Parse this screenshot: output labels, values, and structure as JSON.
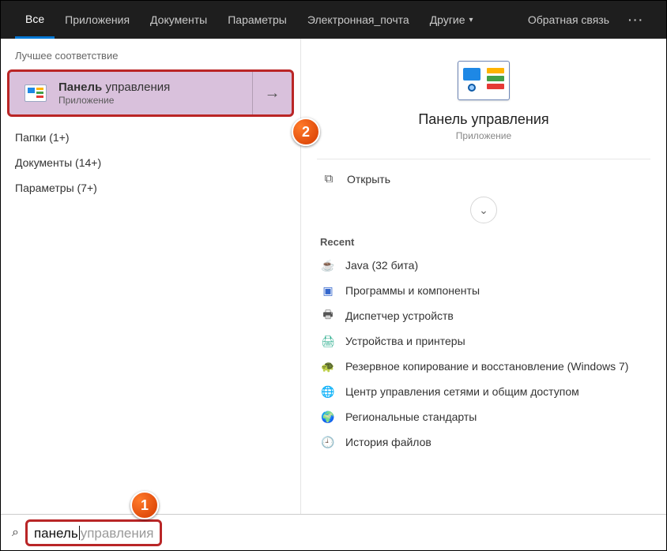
{
  "tabs": {
    "all": "Все",
    "apps": "Приложения",
    "docs": "Документы",
    "settings": "Параметры",
    "email": "Электронная_почта",
    "other": "Другие"
  },
  "feedback": "Обратная связь",
  "more": "···",
  "left": {
    "best_header": "Лучшее соответствие",
    "best_title_b": "Панель",
    "best_title_rest": " управления",
    "best_sub": "Приложение",
    "groups": {
      "folders": "Папки (1+)",
      "documents": "Документы (14+)",
      "settings": "Параметры (7+)"
    }
  },
  "right": {
    "title": "Панель управления",
    "sub": "Приложение",
    "open": "Открыть",
    "recent": "Recent",
    "items": {
      "java": "Java (32 бита)",
      "programs": "Программы и компоненты",
      "devmgr": "Диспетчер устройств",
      "printers": "Устройства и принтеры",
      "backup": "Резервное копирование и восстановление (Windows 7)",
      "network": "Центр управления сетями и общим доступом",
      "region": "Региональные стандарты",
      "history": "История файлов"
    }
  },
  "search": {
    "typed": "панель",
    "suggest": "управления"
  },
  "callouts": {
    "one": "1",
    "two": "2"
  }
}
